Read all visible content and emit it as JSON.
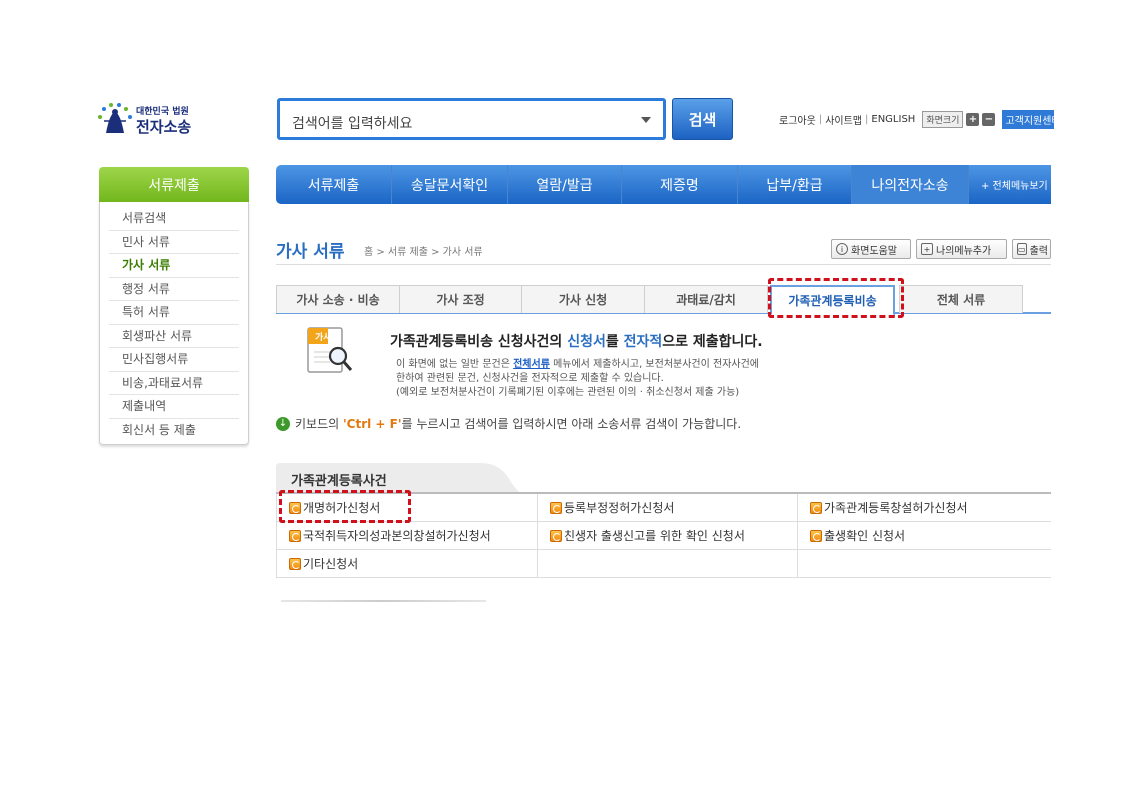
{
  "logo": {
    "sub": "대한민국 법원",
    "main": "전자소송"
  },
  "search": {
    "placeholder": "검색어를 입력하세요",
    "button": "검색"
  },
  "top_links": {
    "logout": "로그아웃",
    "sitemap": "사이트맵",
    "english": "ENGLISH",
    "zoom_label": "화면크기",
    "zoom_in": "+",
    "zoom_out": "−",
    "support": "고객지원센터"
  },
  "lnb": {
    "title": "서류제출",
    "items": [
      "서류검색",
      "민사 서류",
      "가사 서류",
      "행정 서류",
      "특허 서류",
      "회생파산 서류",
      "민사집행서류",
      "비송,과태료서류",
      "제출내역",
      "회신서 등 제출"
    ]
  },
  "gnb": {
    "items": [
      "서류제출",
      "송달문서확인",
      "열람/발급",
      "제증명",
      "납부/환급",
      "나의전자소송"
    ],
    "all_menu": "+ 전체메뉴보기"
  },
  "page": {
    "title": "가사 서류",
    "breadcrumb": "홈 > 서류 제출 > 가사 서류",
    "help_btn": "화면도움말",
    "mymenu_btn": "나의메뉴추가",
    "print_btn": "출력"
  },
  "tabs": [
    "가사 소송 · 비송",
    "가사 조정",
    "가사 신청",
    "과태료/감치",
    "가족관계등록비송",
    "전체 서류"
  ],
  "intro": {
    "icon_label": "가사",
    "title_a": "가족관계등록비송 신청사건의 ",
    "title_b": "신청서",
    "title_c": "를 ",
    "title_d": "전자적",
    "title_e": "으로 제출합니다.",
    "desc1_a": "이 화면에 없는 일반 문건은 ",
    "desc1_link": "전체서류",
    "desc1_b": " 메뉴에서 제출하시고, 보전처분사건이 전자사건에",
    "desc2": "한하여 관련된 문건, 신청사건을 전자적으로 제출할 수 있습니다.",
    "desc3": "(예외로 보전처분사건이 기록폐기된 이후에는 관련된 이의 · 취소신청서 제출 가능)"
  },
  "kbd_tip": {
    "a": "키보드의 ",
    "key": "'Ctrl + F'",
    "b": "를 누르시고 검색어를 입력하시면 아래 소송서류 검색이 가능합니다."
  },
  "section": {
    "title": "가족관계등록사건",
    "rows": [
      [
        "개명허가신청서",
        "등록부정정허가신청서",
        "가족관계등록창설허가신청서"
      ],
      [
        "국적취득자의성과본의창설허가신청서",
        "친생자 출생신고를 위한 확인 신청서",
        "출생확인 신청서"
      ],
      [
        "기타신청서",
        "",
        ""
      ]
    ]
  },
  "colors": {
    "accent_blue": "#1b65c6",
    "lnb_green": "#72b71d",
    "highlight_red": "#d0101a"
  }
}
